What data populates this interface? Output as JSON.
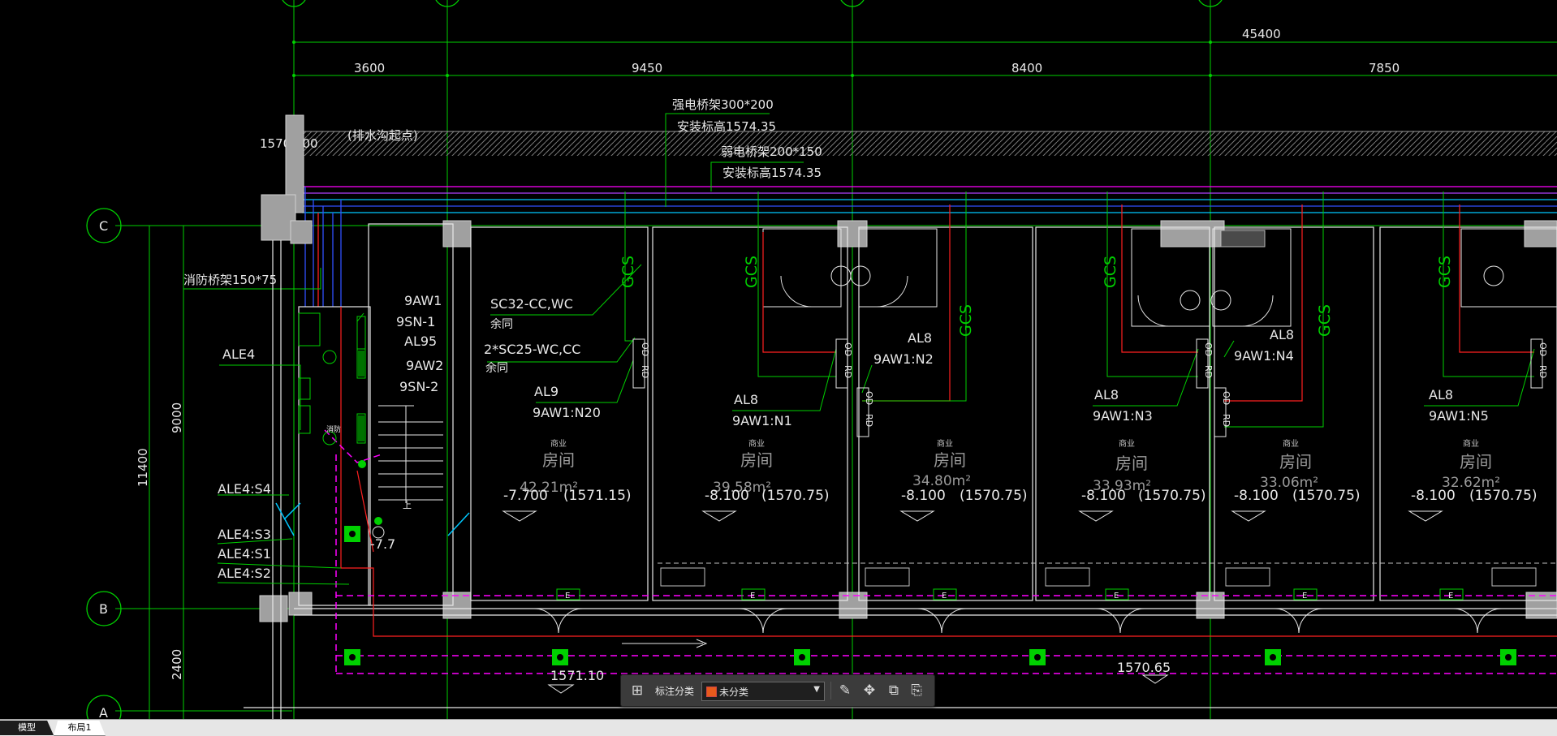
{
  "drawing": {
    "dimensions": {
      "total": "45400",
      "d1": "3600",
      "d2": "9450",
      "d3": "8400",
      "d4": "7850",
      "v_total": "11400",
      "v_top": "9000",
      "v_bottom": "2400"
    },
    "grid_axes": {
      "h1": "C",
      "h2": "B",
      "h3": "A"
    },
    "labels": {
      "elev_left": "1570.800",
      "drain_start": "(排水沟起点)",
      "tray_power": "强电桥架300*200",
      "tray_power_elev": "安装标高1574.35",
      "tray_weak": "弱电桥架200*150",
      "tray_weak_elev": "安装标高1574.35",
      "tray_fire": "消防桥架150*75",
      "ale4": "ALE4",
      "ale4_s4": "ALE4:S4",
      "ale4_s3": "ALE4:S3",
      "ale4_s1": "ALE4:S1",
      "ale4_s2": "ALE4:S2",
      "aw1": "9AW1",
      "sn1": "9SN-1",
      "al95": "AL95",
      "aw2": "9AW2",
      "sn2": "9SN-2",
      "sc32": "SC32-CC,WC",
      "spare1": "余同",
      "sc25": "2*SC25-WC,CC",
      "spare2": "余同",
      "al9": "AL9",
      "n20": "9AW1:N20",
      "al8": "AL8",
      "n1": "9AW1:N1",
      "n2": "9AW1:N2",
      "n3": "9AW1:N3",
      "n4": "9AW1:N4",
      "n5": "9AW1:N5",
      "gcs": "GCS",
      "od": "OD",
      "rd": "RD",
      "e": "E",
      "elev_1571": "1571.10",
      "elev_1570_65": "1570.65",
      "minus77": "-7.7",
      "b_label": "消防",
      "stair": "上"
    },
    "rooms": [
      {
        "use": "商业",
        "name": "房间",
        "area": "42.21m²",
        "level": "-7.700",
        "elev": "(1571.15)"
      },
      {
        "use": "商业",
        "name": "房间",
        "area": "39.58m²",
        "level": "-8.100",
        "elev": "(1570.75)"
      },
      {
        "use": "商业",
        "name": "房间",
        "area": "34.80m²",
        "level": "-8.100",
        "elev": "(1570.75)"
      },
      {
        "use": "商业",
        "name": "房间",
        "area": "33.93m²",
        "level": "-8.100",
        "elev": "(1570.75)"
      },
      {
        "use": "商业",
        "name": "房间",
        "area": "33.06m²",
        "level": "-8.100",
        "elev": "(1570.75)"
      },
      {
        "use": "商业",
        "name": "房间",
        "area": "32.62m²",
        "level": "-8.100",
        "elev": "(1570.75)"
      }
    ]
  },
  "toolbar": {
    "category_label": "标注分类",
    "category_value": "未分类",
    "icons": [
      "grid-icon",
      "edit-icon",
      "move-icon",
      "copy-icon",
      "paste-icon"
    ]
  },
  "tabs": {
    "model": "模型",
    "layout1": "布局1"
  },
  "colors": {
    "axis_green": "#00d000",
    "white": "#e8e8e8",
    "red": "#ff2020",
    "magenta": "#ff00ff",
    "cyan": "#00c8ff",
    "yellow": "#e0e000",
    "blue": "#3050ff",
    "gray": "#9a9a9a"
  }
}
